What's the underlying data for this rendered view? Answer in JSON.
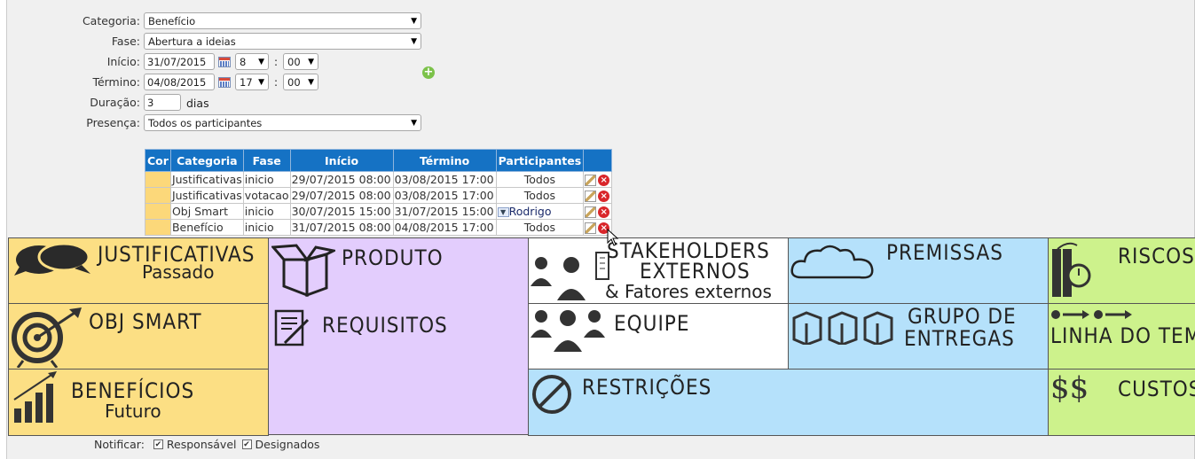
{
  "form": {
    "categoria_label": "Categoria:",
    "categoria_value": "Benefício",
    "fase_label": "Fase:",
    "fase_value": "Abertura a ideias",
    "inicio_label": "Início:",
    "inicio_date": "31/07/2015",
    "inicio_hour": "8",
    "inicio_min": "00",
    "termino_label": "Término:",
    "termino_date": "04/08/2015",
    "termino_hour": "17",
    "termino_min": "00",
    "time_sep": ":",
    "duracao_label": "Duração:",
    "duracao_value": "3",
    "duracao_unit": "dias",
    "presenca_label": "Presença:",
    "presenca_value": "Todos os participantes"
  },
  "table": {
    "headers": [
      "Cor",
      "Categoria",
      "Fase",
      "Início",
      "Término",
      "Participantes"
    ],
    "rows": [
      {
        "categoria": "Justificativas",
        "fase": "inicio",
        "inicio": "29/07/2015 08:00",
        "termino": "03/08/2015 17:00",
        "participantes": "Todos"
      },
      {
        "categoria": "Justificativas",
        "fase": "votacao",
        "inicio": "29/07/2015 08:00",
        "termino": "03/08/2015 17:00",
        "participantes": "Todos"
      },
      {
        "categoria": "Obj Smart",
        "fase": "inicio",
        "inicio": "30/07/2015 15:00",
        "termino": "31/07/2015 15:00",
        "participantes": "Rodrigo"
      },
      {
        "categoria": "Benefício",
        "fase": "inicio",
        "inicio": "31/07/2015 08:00",
        "termino": "04/08/2015 17:00",
        "participantes": "Todos"
      }
    ]
  },
  "canvas": {
    "justificativas": "JUSTIFICATIVAS",
    "passado": "Passado",
    "produto": "PRODUTO",
    "stakeholders_1": "STAKEHOLDERS",
    "stakeholders_2": "EXTERNOS",
    "stakeholders_3": "& Fatores externos",
    "premissas": "PREMISSAS",
    "riscos": "RISCOS",
    "obj_smart": "OBJ SMART",
    "requisitos": "REQUISITOS",
    "equipe": "EQUIPE",
    "grupo_1": "GRUPO DE",
    "grupo_2": "ENTREGAS",
    "linha": "LINHA DO TEMPO",
    "beneficios": "BENEFÍCIOS",
    "futuro": "Futuro",
    "restricoes": "RESTRIÇÕES",
    "custos": "CUSTOS",
    "colors": {
      "yellow": "#fcdf84",
      "purple": "#e3cdfd",
      "blue": "#b5e1fb",
      "green": "#cdf28c",
      "header": "#1572c4"
    }
  },
  "notify": {
    "label": "Notificar:",
    "responsavel": "Responsável",
    "designados": "Designados"
  }
}
